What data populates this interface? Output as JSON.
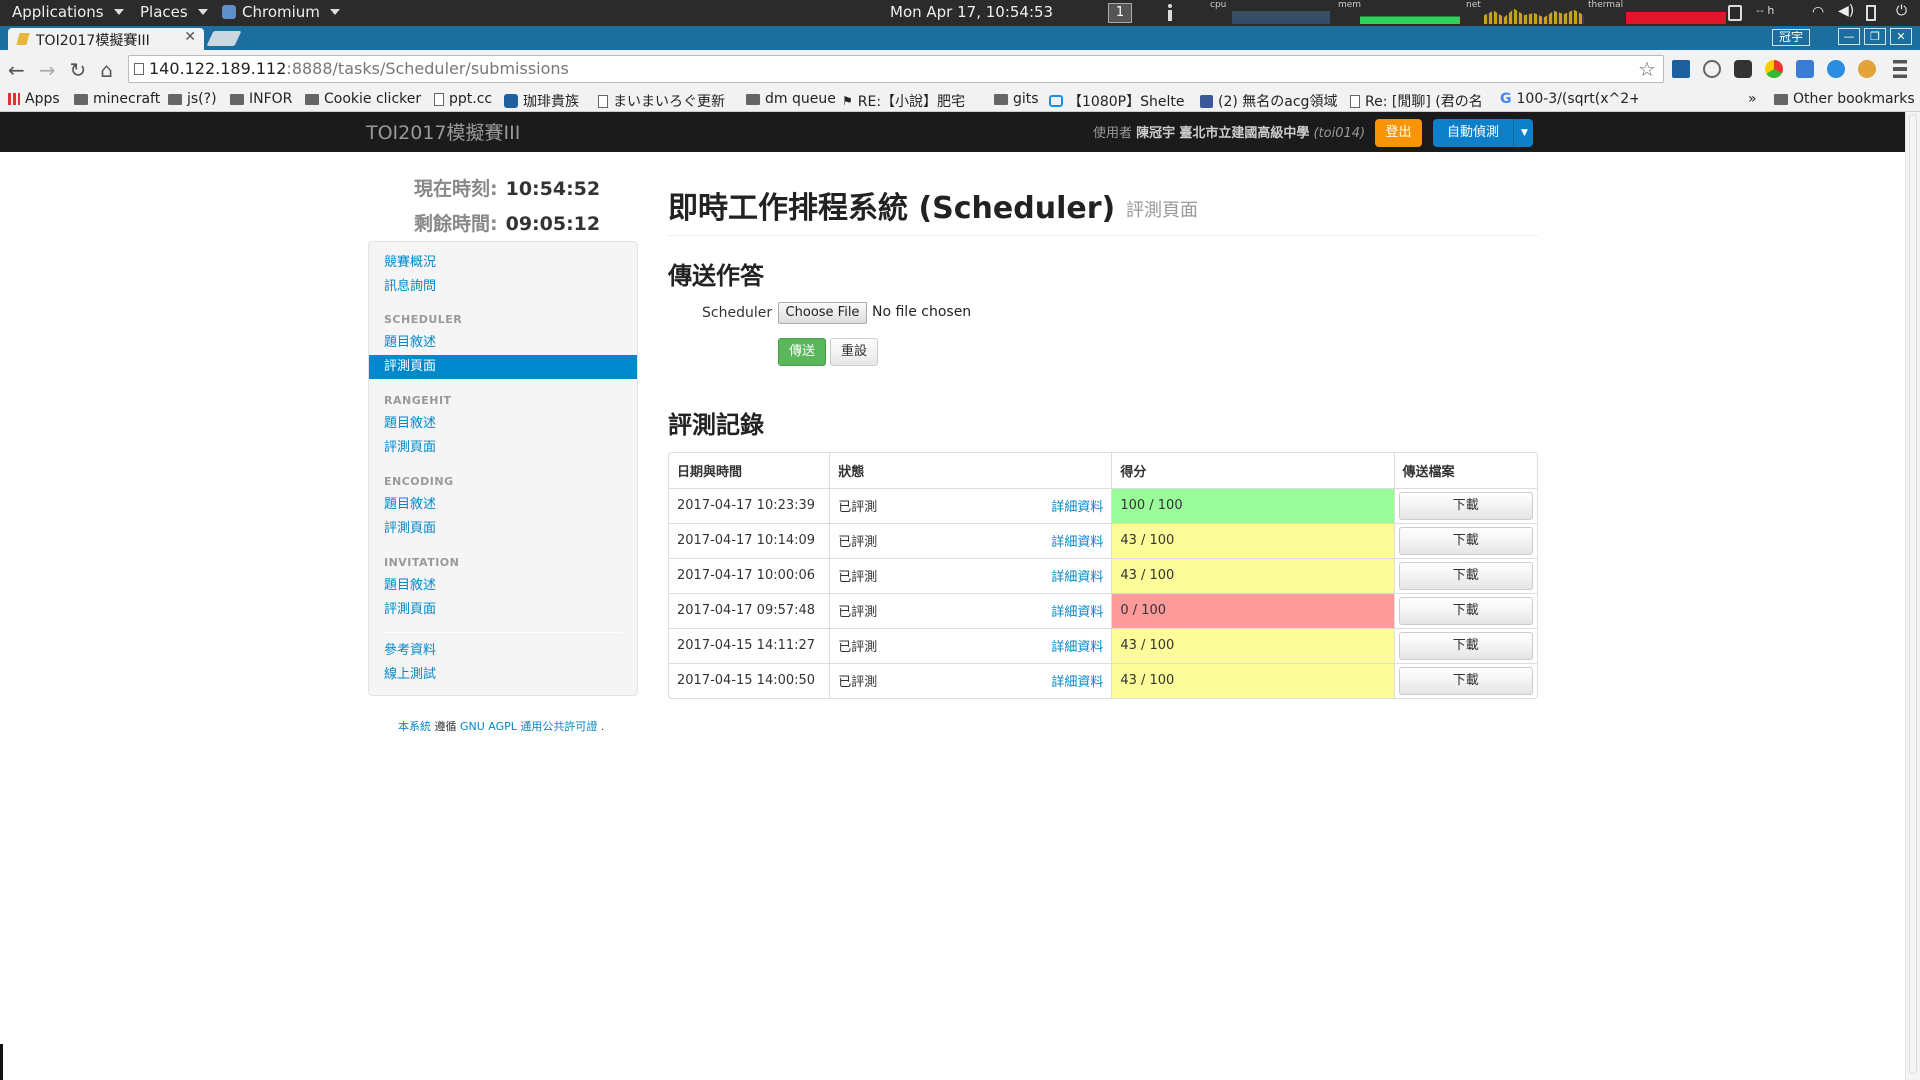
{
  "os_panel": {
    "applications": "Applications",
    "places": "Places",
    "browser": "Chromium",
    "clock": "Mon Apr 17, 10:54:53",
    "workspace": "1",
    "graph_labels": [
      "cpu",
      "mem",
      "net",
      "thermal"
    ],
    "status_text": "-- h"
  },
  "browser": {
    "tab_title": "TOI2017模擬賽III",
    "url_host": "140.122.189.112",
    "url_path": ":8888/tasks/Scheduler/submissions",
    "window_user": "冠宇",
    "bookmarks": [
      {
        "label": "Apps",
        "icon": "apps-grid-icon"
      },
      {
        "label": "minecraft",
        "icon": "folder-icon"
      },
      {
        "label": "js(?)",
        "icon": "folder-icon"
      },
      {
        "label": "INFOR",
        "icon": "folder-icon"
      },
      {
        "label": "Cookie clicker",
        "icon": "folder-icon"
      },
      {
        "label": "ppt.cc",
        "icon": "page-icon"
      },
      {
        "label": "珈琲貴族",
        "icon": "site-icon"
      },
      {
        "label": "まいまいろぐ更新",
        "icon": "page-icon"
      },
      {
        "label": "dm queue",
        "icon": "folder-icon"
      },
      {
        "label": "RE:【小說】肥宅",
        "icon": "site-icon"
      },
      {
        "label": "gits",
        "icon": "folder-icon"
      },
      {
        "label": "【1080P】Shelte",
        "icon": "bilibili-icon"
      },
      {
        "label": "(2) 無名のacg領域",
        "icon": "facebook-icon"
      },
      {
        "label": "Re: [閒聊] (君の名",
        "icon": "page-icon"
      },
      {
        "label": "100-3/(sqrt(x^2+",
        "icon": "google-icon"
      }
    ],
    "more_bookmarks": "»",
    "other_bookmarks": "Other bookmarks"
  },
  "site": {
    "brand": "TOI2017模擬賽III",
    "user_prefix": "使用者",
    "user_name": "陳冠宇",
    "user_school": "臺北市立建國高級中學",
    "user_id": "(toi014)",
    "logout": "登出",
    "auto_test": "自動偵測"
  },
  "clock": {
    "now_label": "現在時刻:",
    "now_value": "10:54:52",
    "remain_label": "剩餘時間:",
    "remain_value": "09:05:12"
  },
  "sidebar": {
    "overview": "競賽概況",
    "messages": "訊息詢問",
    "sections": [
      {
        "title": "SCHEDULER",
        "statement": "題目敘述",
        "submissions": "評測頁面"
      },
      {
        "title": "RANGEHIT",
        "statement": "題目敘述",
        "submissions": "評測頁面"
      },
      {
        "title": "ENCODING",
        "statement": "題目敘述",
        "submissions": "評測頁面"
      },
      {
        "title": "INVITATION",
        "statement": "題目敘述",
        "submissions": "評測頁面"
      }
    ],
    "references": "參考資料",
    "online_test": "線上測試"
  },
  "license": {
    "pre": "本系統",
    "mid": "遵循",
    "link": "GNU AGPL 通用公共許可證",
    "post": "."
  },
  "main": {
    "title": "即時工作排程系統 (Scheduler)",
    "subtitle": "評測頁面",
    "submit_heading": "傳送作答",
    "file_label": "Scheduler",
    "choose_file": "Choose File",
    "no_file": "No file chosen",
    "send": "傳送",
    "reset": "重設",
    "records_heading": "評測記錄"
  },
  "table": {
    "headers": [
      "日期與時間",
      "狀態",
      "得分",
      "傳送檔案"
    ],
    "detail_label": "詳細資料",
    "download_label": "下載",
    "rows": [
      {
        "time": "2017-04-17 10:23:39",
        "status": "已評測",
        "score": "100 / 100",
        "level": "full"
      },
      {
        "time": "2017-04-17 10:14:09",
        "status": "已評測",
        "score": "43 / 100",
        "level": "part"
      },
      {
        "time": "2017-04-17 10:00:06",
        "status": "已評測",
        "score": "43 / 100",
        "level": "part"
      },
      {
        "time": "2017-04-17 09:57:48",
        "status": "已評測",
        "score": "0 / 100",
        "level": "zero"
      },
      {
        "time": "2017-04-15 14:11:27",
        "status": "已評測",
        "score": "43 / 100",
        "level": "part"
      },
      {
        "time": "2017-04-15 14:00:50",
        "status": "已評測",
        "score": "43 / 100",
        "level": "part"
      }
    ]
  },
  "colors": {
    "accent": "#0088cc",
    "score_full": "#9bfc9b",
    "score_partial": "#fdfc9b",
    "score_zero": "#fd9b9b",
    "logout": "#f89406",
    "send": "#5bb75b"
  }
}
